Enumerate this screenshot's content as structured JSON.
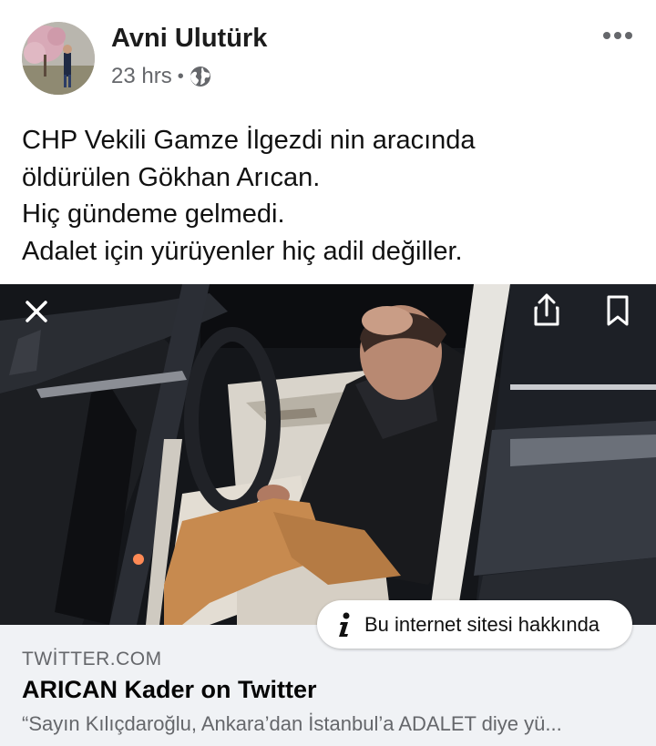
{
  "post": {
    "author": "Avni Ulutürk",
    "time": "23 hrs",
    "separator": "•",
    "privacy_icon": "globe-icon",
    "more_icon": "more-horizontal-icon",
    "text_lines": [
      "CHP Vekili Gamze İlgezdi nin aracında",
      "öldürülen Gökhan Arıcan.",
      "Hiç gündeme gelmedi.",
      "Adalet için yürüyenler hiç adil değiller."
    ]
  },
  "media": {
    "close_icon": "close-icon",
    "share_icon": "share-icon",
    "save_icon": "bookmark-icon",
    "about_button": "Bu internet sitesi hakkında",
    "about_icon": "info-icon"
  },
  "link": {
    "domain": "TWİTTER.COM",
    "title": "ARICAN Kader on Twitter",
    "description": "“Sayın Kılıçdaroğlu, Ankara’dan İstanbul’a ADALET diye yü..."
  },
  "colors": {
    "background": "#ffffff",
    "card_background": "#f0f2f5",
    "secondary_text": "#65676b"
  }
}
